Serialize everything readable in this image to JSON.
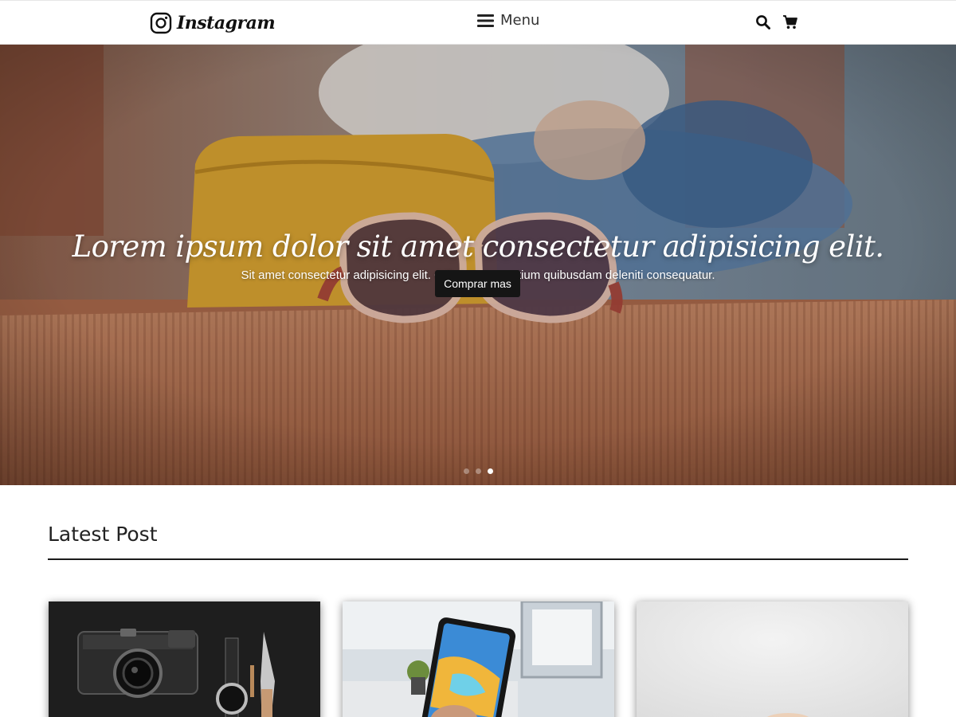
{
  "navbar": {
    "brand": "Instagram",
    "menu_label": "Menu",
    "actions": [
      "search-icon",
      "cart-icon"
    ]
  },
  "hero": {
    "title": "Lorem ipsum dolor sit amet consectetur adipisicing elit.",
    "subtitle": "Sit amet consectetur adipisicing elit. Officiis accusantium quibusdam deleniti consequatur.",
    "cta_label": "Comprar mas",
    "slides_total": 3,
    "active_slide": 3
  },
  "latest": {
    "title": "Latest Post",
    "cards": [
      {
        "image": "camera-flatlay-photo"
      },
      {
        "image": "tablet-in-hand-photo"
      },
      {
        "image": "light-abstract-photo"
      }
    ]
  },
  "colors": {
    "hero_overlay": "#a9684a",
    "button_bg": "#151515",
    "rule": "#1b1b1b"
  }
}
